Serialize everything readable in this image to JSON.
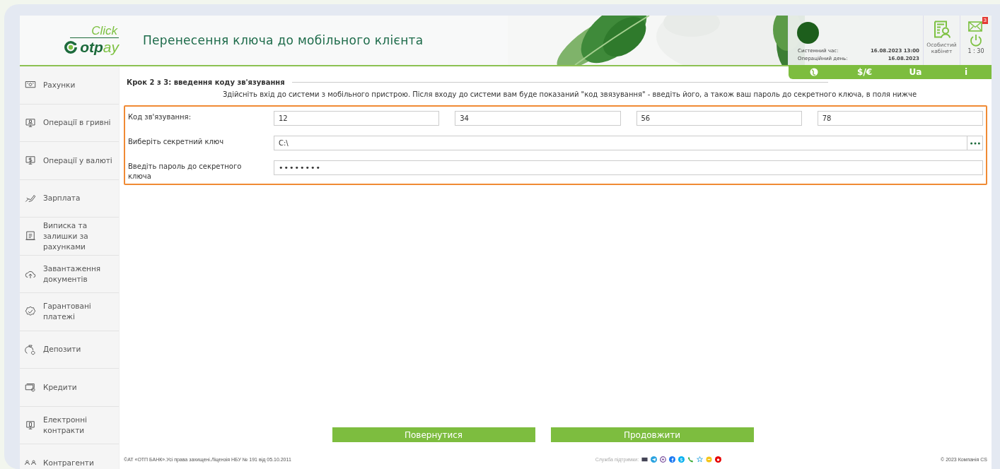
{
  "logo": {
    "tagline": "Click",
    "brand_dark": "otp",
    "brand_light": "ay"
  },
  "header": {
    "title": "Перенесення ключа до мобільного клієнта",
    "system_time_label": "Системний час:",
    "system_time": "16.08.2023 13:00",
    "operational_day_label": "Операційний день:",
    "operational_day": "16.08.2023",
    "cabinet_label": "Особистий кабінет",
    "mail_badge": "3",
    "session_timer": "1 : 30",
    "toolbar": [
      {
        "kind": "globe"
      },
      {
        "kind": "text",
        "label": "$/€"
      },
      {
        "kind": "text",
        "label": "Ua"
      },
      {
        "kind": "text",
        "label": "i"
      }
    ]
  },
  "sidebar": {
    "items": [
      {
        "label": "Рахунки"
      },
      {
        "label": "Операції в гривні"
      },
      {
        "label": "Операції у валюті"
      },
      {
        "label": "Зарплата"
      },
      {
        "label": "Виписка та залишки за рахунками"
      },
      {
        "label": "Завантаження документів"
      },
      {
        "label": "Гарантовані платежі"
      },
      {
        "label": "Депозити"
      },
      {
        "label": "Кредити"
      },
      {
        "label": "Електронні контракти"
      },
      {
        "label": "Контрагенти"
      }
    ]
  },
  "form": {
    "step_title": "Крок 2 з 3: введення коду зв'язування",
    "instruction": "Здійсніть вхід до системи з мобільного пристрою. Після входу до системи вам буде показаний \"код звязування\" - введіть його, а також ваш пароль до секретного ключа, в поля нижче",
    "fields": [
      {
        "kind": "code",
        "label": "Код зв'язування:",
        "values": [
          "12",
          "34",
          "56",
          "78"
        ]
      },
      {
        "kind": "file",
        "label": "Виберіть секретний ключ",
        "value": "C:\\"
      },
      {
        "kind": "password",
        "label": "Введіть пароль до секретного ключа",
        "value": "••••••••"
      }
    ]
  },
  "buttons": [
    {
      "label": "Повернутися"
    },
    {
      "label": "Продовжити"
    }
  ],
  "footer": {
    "copyright": "©АТ «ОТП БАНК».Усі права захищені.Ліцензія НБУ № 191 від 05.10.2011",
    "support_label": "Служба підтримки:",
    "company": "© 2023 Компанія CS"
  }
}
